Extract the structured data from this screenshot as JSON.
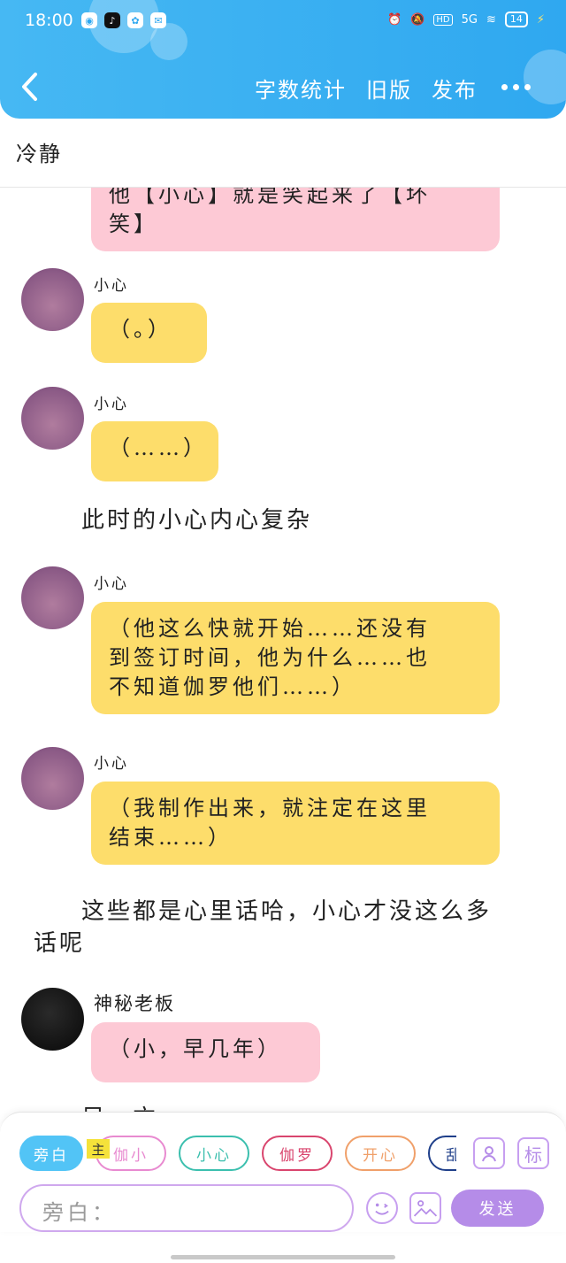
{
  "status_bar": {
    "time": "18:00",
    "network": "5G",
    "battery": "14"
  },
  "header": {
    "actions": [
      "字数统计",
      "旧版",
      "发布"
    ]
  },
  "story_title": "冷静",
  "messages": [
    {
      "type": "bubble",
      "sender": "",
      "text": "他【小心】就是笑起来了【坏\n笑】",
      "color": "pink"
    },
    {
      "type": "bubble",
      "sender": "小心",
      "text": "（。）",
      "color": "yellow"
    },
    {
      "type": "bubble",
      "sender": "小心",
      "text": "（……）",
      "color": "yellow"
    },
    {
      "type": "narration",
      "text": "此时的小心内心复杂"
    },
    {
      "type": "bubble",
      "sender": "小心",
      "text": "（他这么快就开始……还没有\n到签订时间，他为什么……也\n不知道伽罗他们……）",
      "color": "yellow"
    },
    {
      "type": "bubble",
      "sender": "小心",
      "text": "（我制作出来，就注定在这里\n结束……）",
      "color": "yellow"
    },
    {
      "type": "narration",
      "text": "这些都是心里话哈，小心才没这么多\n话呢"
    },
    {
      "type": "bubble",
      "sender": "神秘老板",
      "text": "（小，早几年）",
      "color": "pink"
    },
    {
      "type": "narration",
      "text": "另一方"
    }
  ],
  "roles": [
    {
      "label": "旁白",
      "color": "#52c4f6",
      "active": true
    },
    {
      "label": "伽小",
      "color": "#e88ad0"
    },
    {
      "label": "小心",
      "color": "#3bbfae"
    },
    {
      "label": "伽罗",
      "color": "#d9456e"
    },
    {
      "label": "开心",
      "color": "#f0a06a"
    },
    {
      "label": "乱",
      "color": "#1f3f8a"
    }
  ],
  "main_tag": "主",
  "tools": {
    "role_icon": "user-card-icon",
    "mark": "标"
  },
  "input": {
    "placeholder": "旁白："
  },
  "send_label": "发送"
}
